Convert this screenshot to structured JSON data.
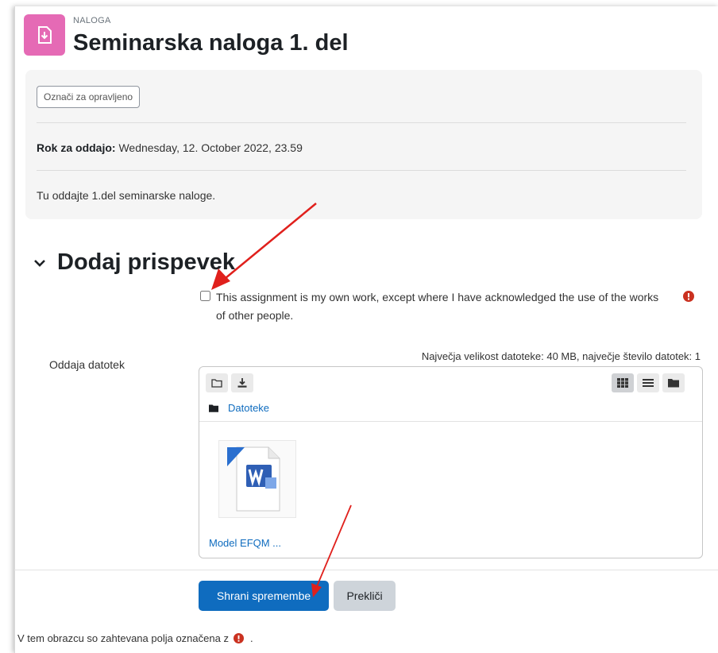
{
  "header": {
    "activity_type": "NALOGA",
    "title": "Seminarska naloga 1. del",
    "icon": "assignment-icon",
    "icon_color": "#e56ab5"
  },
  "info": {
    "mark_done_label": "Označi za opravljeno",
    "due_label": "Rok za oddajo:",
    "due_value": "Wednesday, 12. October 2022, 23.59",
    "description": "Tu oddajte 1.del seminarske naloge."
  },
  "submission": {
    "section_title": "Dodaj prispevek",
    "acknowledgement": "This assignment is my own work, except where I have acknowledged the use of the works of other people.",
    "acknowledgement_checked": false,
    "file_label": "Oddaja datotek",
    "limits": "Največja velikost datoteke: 40 MB, največje število datotek: 1",
    "files_path": "Datoteke",
    "file_name": "Model EFQM ...",
    "file_type_icon": "word-document-icon"
  },
  "actions": {
    "save_label": "Shrani spremembe",
    "cancel_label": "Prekliči"
  },
  "footer": {
    "required_note": "V tem obrazcu so zahtevana polja označena z",
    "required_suffix": "."
  },
  "colors": {
    "primary": "#0f6cbf",
    "required": "#ca3120",
    "annotation_arrow": "#e0201c"
  }
}
